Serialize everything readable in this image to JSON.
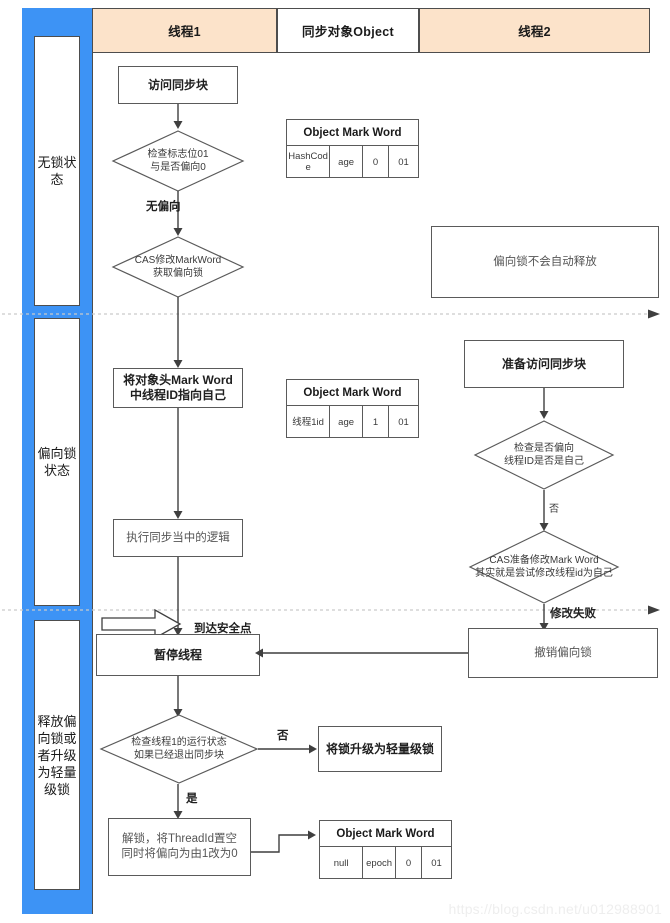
{
  "lanes": {
    "headers": [
      {
        "label": "线程1",
        "style": "peach"
      },
      {
        "label": "同步对象Object",
        "style": "white"
      },
      {
        "label": "线程2",
        "style": "peach"
      }
    ]
  },
  "state_rail": {
    "color": "#3d93f5",
    "states": [
      {
        "label": "无锁状态"
      },
      {
        "label": "偏向锁状态"
      },
      {
        "label": "释放偏向锁或者升级为轻量级锁"
      }
    ]
  },
  "thread1": {
    "access_sync_block": "访问同步块",
    "check_flag": "检查标志位01\n与是否偏向0",
    "no_bias_label": "无偏向",
    "cas_modify": "CAS修改MarkWord\n获取偏向锁",
    "point_thread_id": "将对象头Mark Word\n中线程ID指向自己",
    "exec_logic": "执行同步当中的逻辑",
    "safe_point_label": "到达安全点",
    "pause_thread": "暂停线程",
    "check_running": "检查线程1的运行状态\n如果已经退出同步块",
    "no_label": "否",
    "yes_label": "是",
    "upgrade_lock": "将锁升级为轻量级锁",
    "unlock": "解锁，将ThreadId置空\n同时将偏向为由1改为0"
  },
  "thread2": {
    "prepare_access": "准备访问同步块",
    "check_bias": "检查是否偏向\n线程ID是否是自己",
    "no_label": "否",
    "cas_prepare": "CAS准备修改Mark Word\n其实就是尝试修改线程id为自己",
    "modify_fail_label": "修改失败",
    "revoke_bias": "撤销偏向锁",
    "note_bias_not_released": "偏向锁不会自动释放"
  },
  "mark_words": [
    {
      "title": "Object Mark Word",
      "cells": [
        "HashCode",
        "age",
        "0",
        "01"
      ]
    },
    {
      "title": "Object Mark Word",
      "cells": [
        "线程1id",
        "age",
        "1",
        "01"
      ]
    },
    {
      "title": "Object Mark Word",
      "cells": [
        "null",
        "epoch",
        "0",
        "01"
      ]
    }
  ],
  "watermark": "https://blog.csdn.net/u012988901"
}
